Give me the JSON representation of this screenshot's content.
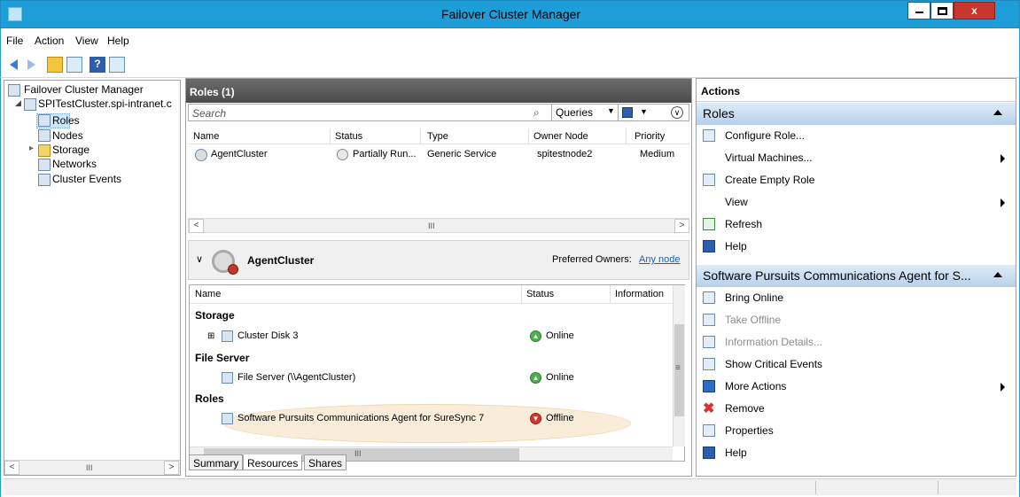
{
  "window": {
    "title": "Failover Cluster Manager",
    "close_glyph": "x"
  },
  "menu": [
    "File",
    "Action",
    "View",
    "Help"
  ],
  "tree": {
    "root": "Failover Cluster Manager",
    "cluster": "SPITestCluster.spi-intranet.c",
    "items": [
      "Roles",
      "Nodes",
      "Storage",
      "Networks",
      "Cluster Events"
    ],
    "expander": "▸",
    "collapser": "◢",
    "scroll_left": "<",
    "scroll_right": ">",
    "scroll_grip": "III"
  },
  "roles_panel": {
    "title": "Roles (1)",
    "search_placeholder": "Search",
    "queries_label": "Queries",
    "columns": [
      "Name",
      "Status",
      "Type",
      "Owner Node",
      "Priority"
    ],
    "rows": [
      {
        "name": "AgentCluster",
        "status": "Partially Run...",
        "type": "Generic Service",
        "owner_node": "spitestnode2",
        "priority": "Medium"
      }
    ],
    "scroll_left": "<",
    "scroll_right": ">",
    "scroll_grip": "III"
  },
  "detail": {
    "title": "AgentCluster",
    "preferred_owners_label": "Preferred Owners:",
    "preferred_owners_link": "Any node",
    "columns": [
      "Name",
      "Status",
      "Information"
    ],
    "groups": {
      "storage": "Storage",
      "file_server": "File Server",
      "roles": "Roles"
    },
    "items": {
      "disk": {
        "name": "Cluster Disk 3",
        "status": "Online"
      },
      "fileserver": {
        "name": "File Server (\\\\AgentCluster)",
        "status": "Online"
      },
      "role": {
        "name": "Software Pursuits Communications Agent for SureSync 7",
        "status": "Offline"
      }
    },
    "expand_glyph": "⊞",
    "scroll_grip": "III",
    "vscroll_grip": "≡"
  },
  "bottom_tabs": [
    "Summary",
    "Resources",
    "Shares"
  ],
  "actions": {
    "title": "Actions",
    "section1": {
      "header": "Roles",
      "items": [
        {
          "label": "Configure Role...",
          "submenu": false,
          "disabled": false
        },
        {
          "label": "Virtual Machines...",
          "submenu": true,
          "disabled": false
        },
        {
          "label": "Create Empty Role",
          "submenu": false,
          "disabled": false
        },
        {
          "label": "View",
          "submenu": true,
          "disabled": false
        },
        {
          "label": "Refresh",
          "submenu": false,
          "disabled": false
        },
        {
          "label": "Help",
          "submenu": false,
          "disabled": false
        }
      ]
    },
    "section2": {
      "header": "Software Pursuits Communications Agent for S...",
      "items": [
        {
          "label": "Bring Online",
          "submenu": false,
          "disabled": false
        },
        {
          "label": "Take Offline",
          "submenu": false,
          "disabled": true
        },
        {
          "label": "Information Details...",
          "submenu": false,
          "disabled": true
        },
        {
          "label": "Show Critical Events",
          "submenu": false,
          "disabled": false
        },
        {
          "label": "More Actions",
          "submenu": true,
          "disabled": false
        },
        {
          "label": "Remove",
          "submenu": false,
          "disabled": false
        },
        {
          "label": "Properties",
          "submenu": false,
          "disabled": false
        },
        {
          "label": "Help",
          "submenu": false,
          "disabled": false
        }
      ]
    }
  },
  "colors": {
    "titlebar": "#1e9ed9",
    "online": "#4cb04c",
    "offline": "#d9352c",
    "link": "#1a5fb4",
    "section_header": "#c8dcf0"
  }
}
